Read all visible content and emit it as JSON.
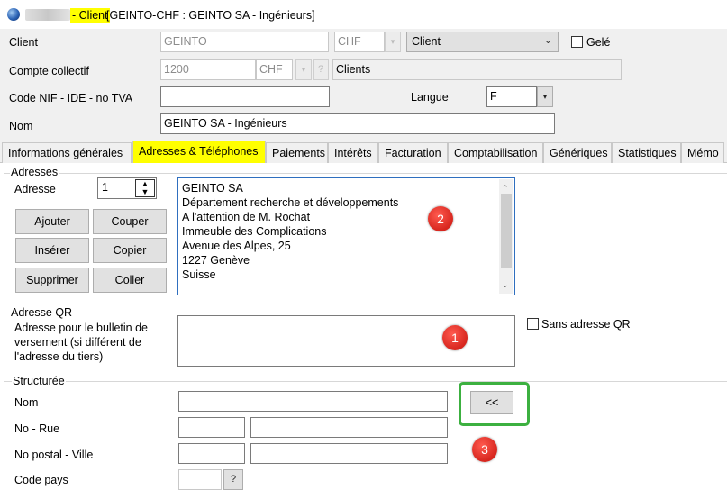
{
  "window": {
    "title_highlight": "- Client",
    "title_rest": "[GEINTO-CHF : GEINTO SA - Ingénieurs]"
  },
  "header": {
    "client_label": "Client",
    "client_code": "GEINTO",
    "client_currency": "CHF",
    "client_type": "Client",
    "gele_label": "Gelé",
    "compte_label": "Compte collectif",
    "compte_number": "1200",
    "compte_currency": "CHF",
    "compte_help": "?",
    "compte_name": "Clients",
    "nif_label": "Code NIF - IDE - no TVA",
    "nif_value": "",
    "langue_label": "Langue",
    "langue_value": "F",
    "nom_label": "Nom",
    "nom_value": "GEINTO SA - Ingénieurs"
  },
  "tabs": [
    {
      "label": "Informations générales"
    },
    {
      "label": "Adresses & Téléphones",
      "active": true
    },
    {
      "label": "Paiements"
    },
    {
      "label": "Intérêts"
    },
    {
      "label": "Facturation"
    },
    {
      "label": "Comptabilisation"
    },
    {
      "label": "Génériques"
    },
    {
      "label": "Statistiques"
    },
    {
      "label": "Mémo"
    }
  ],
  "adresses": {
    "group_label": "Adresses",
    "adresse_label": "Adresse",
    "adresse_index": "1",
    "buttons": {
      "ajouter": "Ajouter",
      "couper": "Couper",
      "inserer": "Insérer",
      "copier": "Copier",
      "supprimer": "Supprimer",
      "coller": "Coller"
    },
    "address_lines": [
      "GEINTO SA",
      "Département recherche et développements",
      "A l'attention de M. Rochat",
      "Immeuble des Complications",
      "Avenue des Alpes, 25",
      "1227 Genève",
      "Suisse"
    ]
  },
  "adresse_qr": {
    "group_label": "Adresse QR",
    "description": "Adresse pour le bulletin de versement (si différent de l'adresse du tiers)",
    "sans_label": "Sans adresse QR"
  },
  "structuree": {
    "group_label": "Structurée",
    "nom_label": "Nom",
    "rue_label": "No - Rue",
    "ville_label": "No postal - Ville",
    "pays_label": "Code pays",
    "pays_help": "?",
    "copy_button": "<<"
  },
  "badges": {
    "one": "1",
    "two": "2",
    "three": "3"
  },
  "colors": {
    "highlight": "#ffff00",
    "badge": "#d7261e",
    "green_frame": "#3cb040"
  }
}
